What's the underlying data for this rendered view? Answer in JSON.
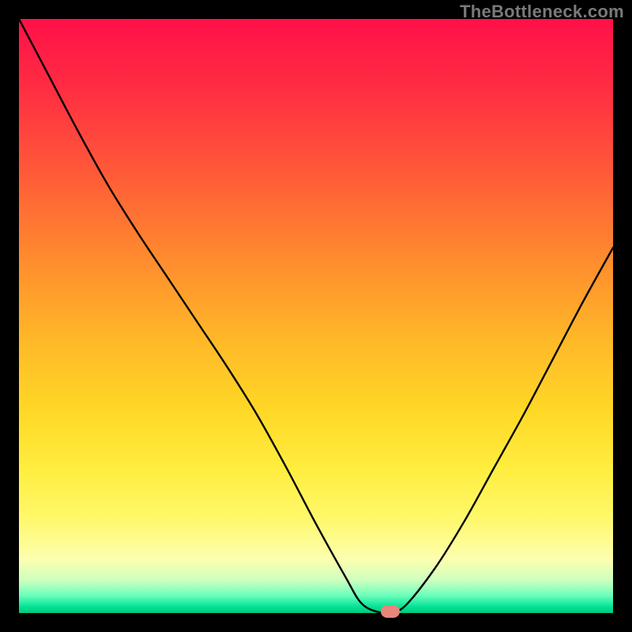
{
  "watermark": "TheBottleneck.com",
  "chart_data": {
    "type": "line",
    "title": "",
    "xlabel": "",
    "ylabel": "",
    "x": [
      0.0,
      0.05,
      0.1,
      0.15,
      0.2,
      0.25,
      0.3,
      0.35,
      0.4,
      0.45,
      0.5,
      0.55,
      0.575,
      0.6,
      0.625,
      0.65,
      0.7,
      0.75,
      0.8,
      0.85,
      0.9,
      0.95,
      1.0
    ],
    "y": [
      1.0,
      0.905,
      0.81,
      0.72,
      0.64,
      0.565,
      0.49,
      0.415,
      0.335,
      0.245,
      0.15,
      0.06,
      0.018,
      0.003,
      0.002,
      0.012,
      0.075,
      0.155,
      0.245,
      0.335,
      0.43,
      0.525,
      0.615
    ],
    "xlim": [
      0,
      1
    ],
    "ylim": [
      0,
      1
    ],
    "marker": {
      "x": 0.625,
      "y": 0.002
    },
    "annotations": []
  }
}
